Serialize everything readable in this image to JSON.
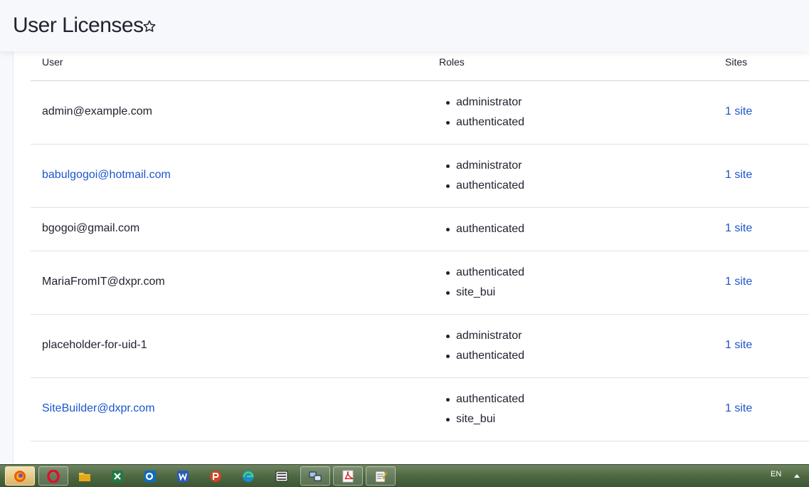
{
  "page": {
    "title": "User Licenses"
  },
  "table": {
    "headers": {
      "user": "User",
      "roles": "Roles",
      "sites": "Sites"
    },
    "rows": [
      {
        "user": "admin@example.com",
        "user_is_link": false,
        "roles": [
          "administrator",
          "authenticated"
        ],
        "sites": "1 site"
      },
      {
        "user": "babulgogoi@hotmail.com",
        "user_is_link": true,
        "roles": [
          "administrator",
          "authenticated"
        ],
        "sites": "1 site"
      },
      {
        "user": "bgogoi@gmail.com",
        "user_is_link": false,
        "roles": [
          "authenticated"
        ],
        "sites": "1 site"
      },
      {
        "user": "MariaFromIT@dxpr.com",
        "user_is_link": false,
        "roles": [
          "authenticated",
          "site_bui"
        ],
        "sites": "1 site"
      },
      {
        "user": "placeholder-for-uid-1",
        "user_is_link": false,
        "roles": [
          "administrator",
          "authenticated"
        ],
        "sites": "1 site"
      },
      {
        "user": "SiteBuilder@dxpr.com",
        "user_is_link": true,
        "roles": [
          "authenticated",
          "site_bui"
        ],
        "sites": "1 site"
      }
    ]
  },
  "taskbar": {
    "apps": [
      "firefox-icon",
      "opera-icon",
      "file-explorer-icon",
      "excel-icon",
      "outlook-icon",
      "word-icon",
      "powerpoint-icon",
      "edge-icon",
      "vnc-icon",
      "network-tool-icon",
      "pdf-reader-icon",
      "notepad-icon"
    ],
    "language": "EN"
  },
  "colors": {
    "link": "#1b56cc",
    "text": "#222330",
    "header_bg": "#f7f8fc"
  }
}
